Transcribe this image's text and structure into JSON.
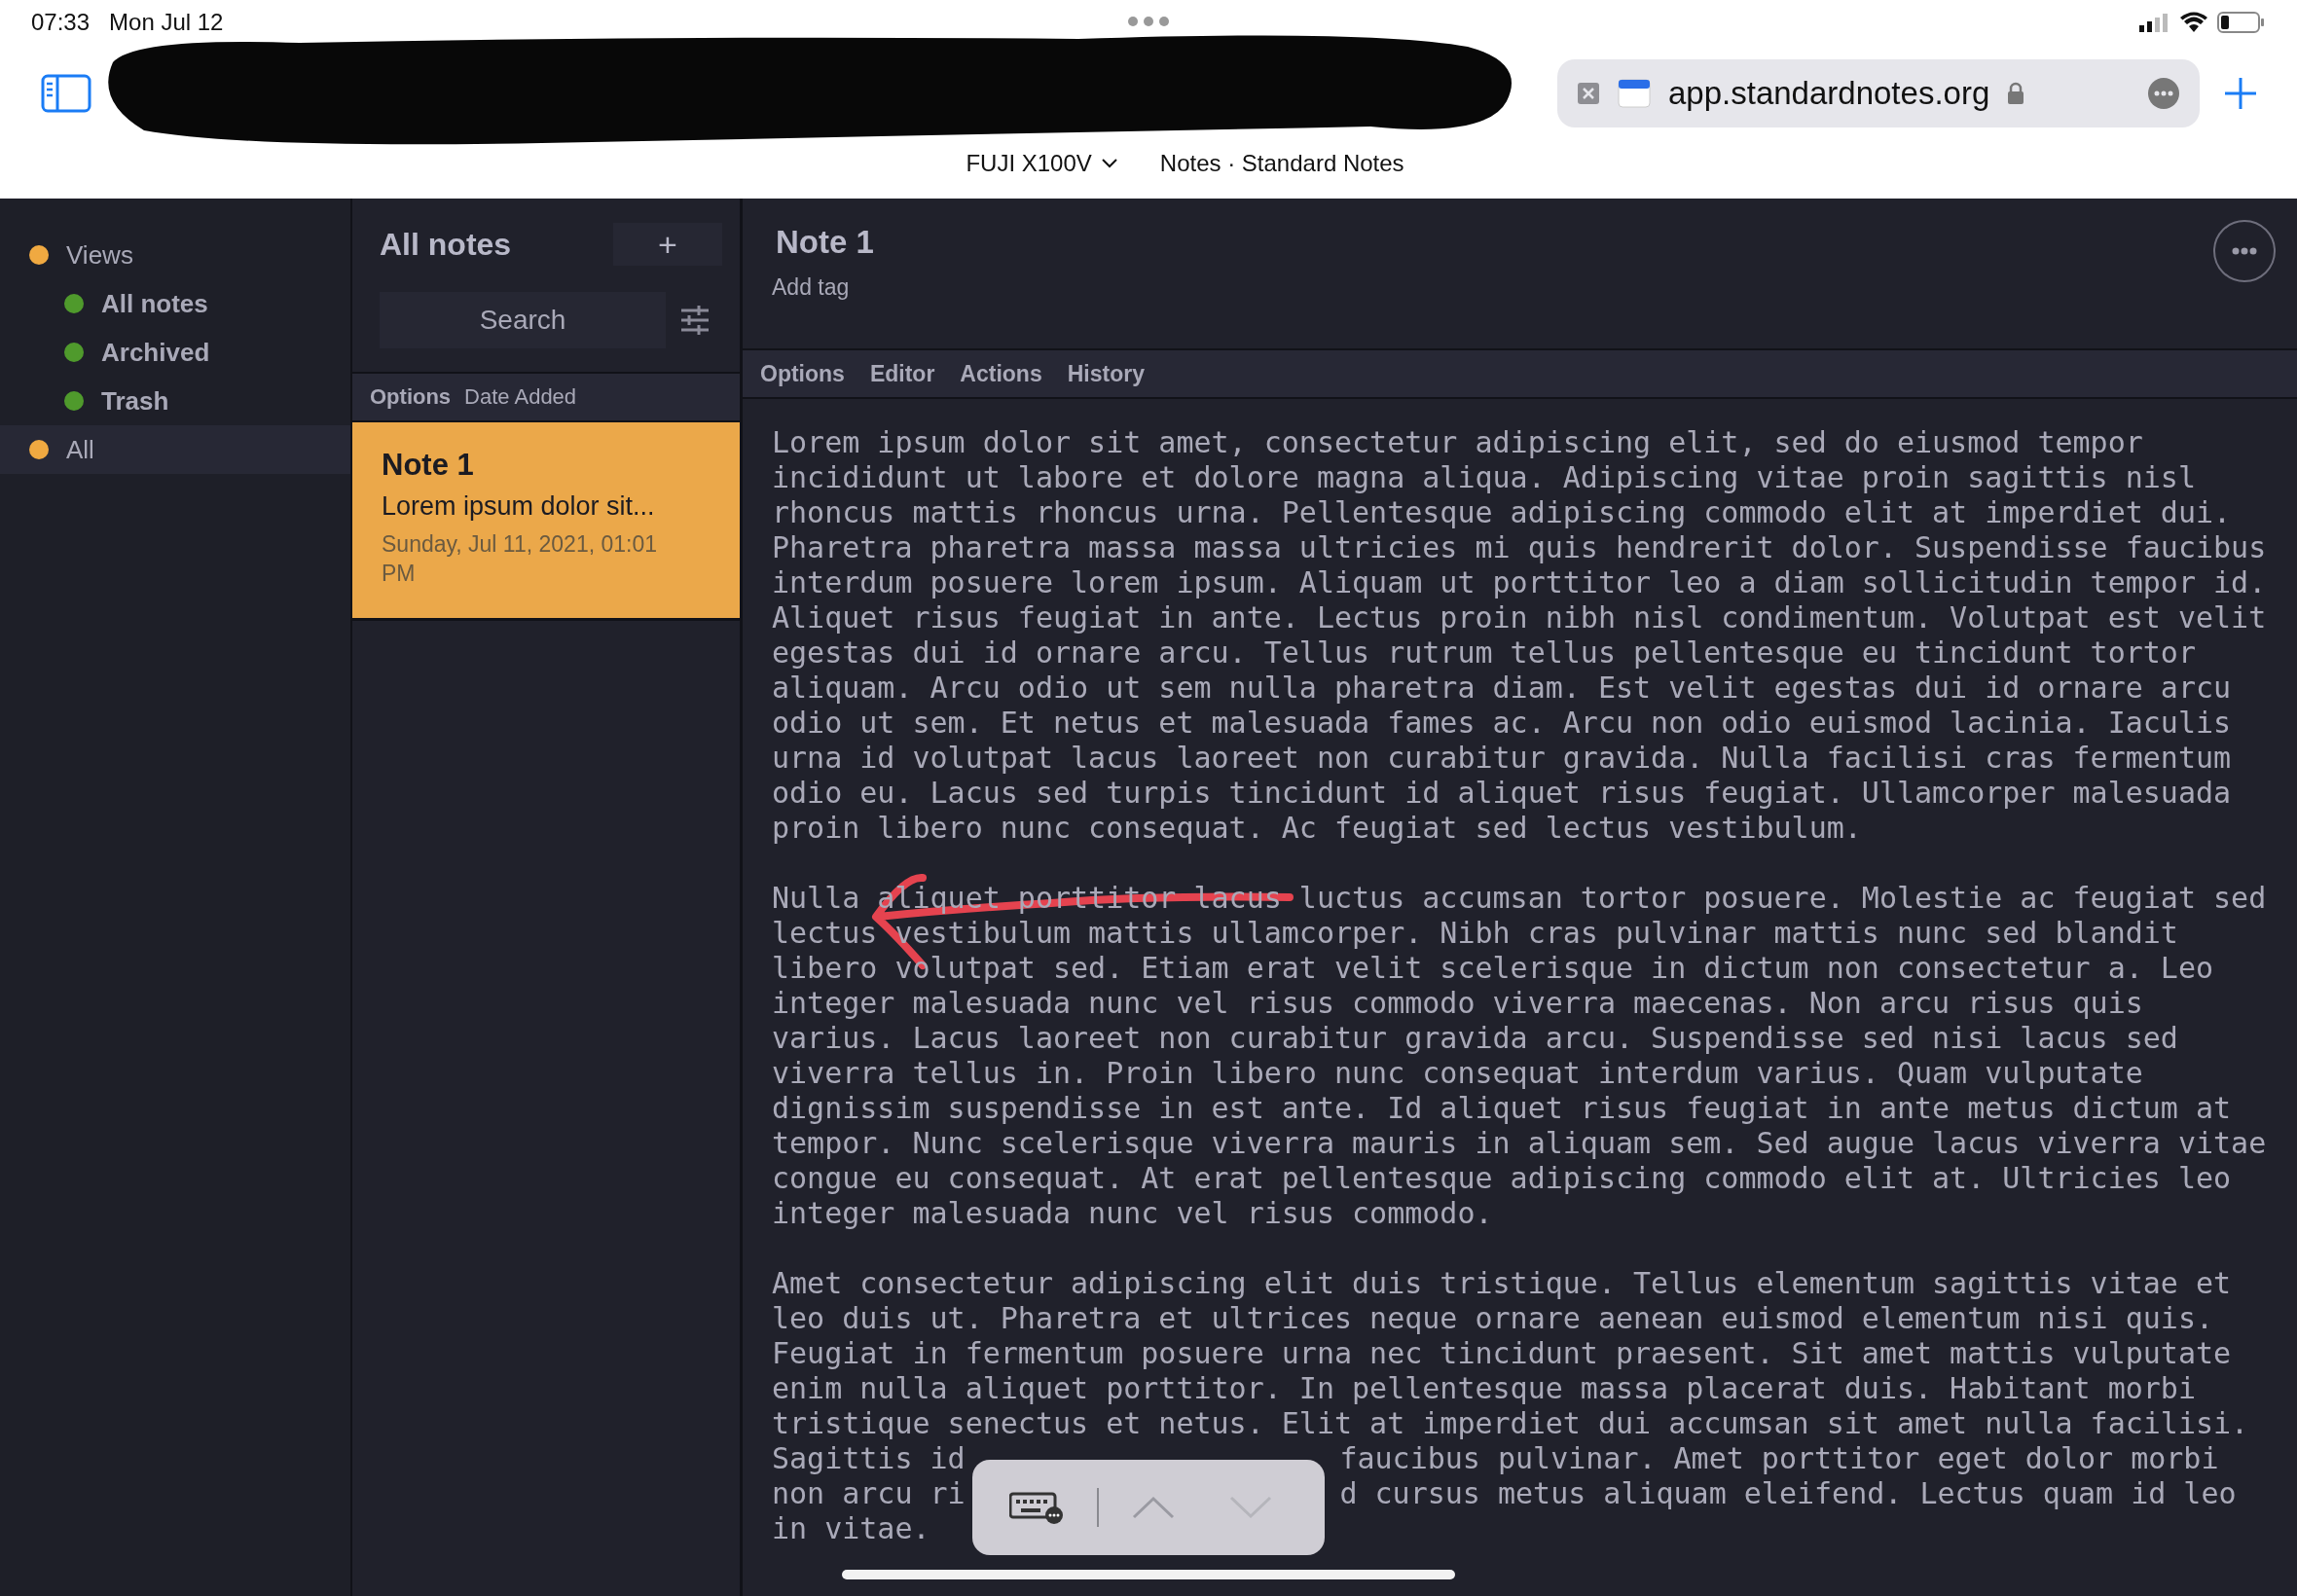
{
  "status_bar": {
    "time": "07:33",
    "date": "Mon Jul 12"
  },
  "browser": {
    "url": "app.standardnotes.org",
    "tab_titles": [
      {
        "label": "FUJI X100V",
        "kind": "menu"
      },
      {
        "label": "Notes · Standard Notes",
        "kind": "plain"
      }
    ]
  },
  "views": [
    {
      "label": "Views",
      "color": "#f0a941",
      "selected": false,
      "children": [
        {
          "label": "All notes",
          "color": "#4f9a2c",
          "selected": false
        },
        {
          "label": "Archived",
          "color": "#4f9a2c",
          "selected": false
        },
        {
          "label": "Trash",
          "color": "#4f9a2c",
          "selected": false
        }
      ]
    },
    {
      "label": "All",
      "color": "#f0a941",
      "selected": true
    }
  ],
  "notes_list": {
    "title": "All notes",
    "new_button": "+",
    "search": {
      "placeholder": "Search"
    },
    "options_label": "Options",
    "sort": "Date Added",
    "notes": [
      {
        "title": "Note 1",
        "preview": "Lorem ipsum dolor sit...",
        "date": "Sunday, Jul 11, 2021, 01:01 PM",
        "selected": true
      }
    ]
  },
  "editor": {
    "title": "Note 1",
    "tag_placeholder": "Add tag",
    "menu": [
      "Options",
      "Editor",
      "Actions",
      "History"
    ],
    "paragraphs": [
      [
        [
          "Lorem ipsum dolor sit amet, consectetur adipiscing elit, sed do eiusmod tempor"
        ],
        [
          "incididunt ut labore et dolore magna aliqua. Adipiscing vitae proin sagittis nisl"
        ],
        [
          "rhoncus mattis rhoncus urna. Pellentesque adipiscing commodo elit at imperdiet dui."
        ],
        [
          "Pharetra pharetra massa massa ultricies mi quis hendrerit dolor. Suspendisse faucibus"
        ],
        [
          "interdum posuere lorem ipsum. Aliquam ut porttitor leo a diam sollicitudin tempor id."
        ],
        [
          "Aliquet risus feugiat in ante. Lectus proin nibh nisl condimentum. Volutpat est velit"
        ],
        [
          "egestas dui id ornare arcu. Tellus rutrum tellus pellentesque eu tincidunt tortor"
        ],
        [
          "aliquam. Arcu odio ut sem nulla pharetra diam. Est velit egestas dui id ornare arcu"
        ],
        [
          "odio ut sem. Et netus et malesuada fames ac. Arcu non odio euismod lacinia. Iaculis"
        ],
        [
          "urna id volutpat lacus laoreet non curabitur gravida. Nulla facilisi cras fermentum"
        ],
        [
          "odio eu. Lacus sed turpis tincidunt id aliquet risus feugiat. Ullamcorper malesuada"
        ],
        [
          "proin libero nunc consequat. Ac feugiat sed lectus vestibulum."
        ]
      ],
      [
        [
          "Nulla aliquet porttitor lacus luctus accumsan tortor posuere. Molestie ac feugiat sed"
        ],
        [
          "lectus vestibulum mattis ullamcorper. Nibh cras pulvinar mattis nunc sed blandit"
        ],
        [
          "libero volutpat sed. Etiam erat velit scelerisque in dictum non consectetur a. Leo"
        ],
        [
          "integer malesuada nunc vel risus commodo viverra maecenas. Non arcu risus quis"
        ],
        [
          "varius. Lacus laoreet non curabitur gravida arcu. Suspendisse sed nisi lacus sed"
        ],
        [
          "viverra tellus in. Proin libero nunc consequat interdum varius. Quam vulputate"
        ],
        [
          "dignissim suspendisse in est ante. Id aliquet risus feugiat in ante metus dictum at"
        ],
        [
          "tempor. Nunc scelerisque viverra mauris in aliquam sem. Sed augue lacus viverra vitae"
        ],
        [
          "congue eu consequat. At erat pellentesque adipiscing commodo elit at. Ultricies leo"
        ],
        [
          "integer malesuada nunc vel risus commodo."
        ]
      ],
      [
        [
          "Amet consectetur adipiscing elit duis tristique. Tellus elementum sagittis vitae et"
        ],
        [
          "leo duis ut. Pharetra et ultrices neque ornare aenean euismod elementum nisi quis."
        ],
        [
          "Feugiat in fermentum posuere urna nec tincidunt praesent. Sit amet mattis vulputate"
        ],
        [
          "enim nulla aliquet porttitor. In pellentesque massa placerat duis. Habitant morbi"
        ],
        [
          "tristique senectus et netus. Elit at imperdiet dui accumsan sit amet nulla facilisi."
        ],
        [
          "Sagittis id",
          "faucibus pulvinar. Amet porttitor eget dolor morbi"
        ],
        [
          "non arcu ri",
          "d cursus metus aliquam eleifend. Lectus quam id leo"
        ],
        [
          "in vitae."
        ]
      ]
    ]
  }
}
